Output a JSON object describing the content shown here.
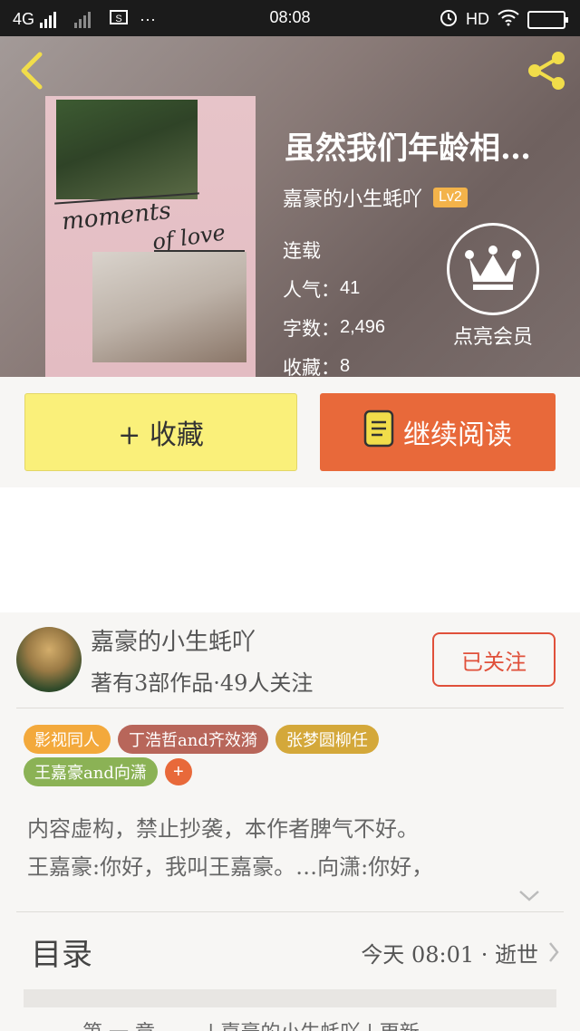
{
  "status_bar": {
    "network": "4G",
    "time": "08:08",
    "hd": "HD",
    "more": "···"
  },
  "book": {
    "title": "虽然我们年龄相…",
    "author": "嘉豪的小生蚝吖",
    "level": "Lv2",
    "status": "连载",
    "popularity_label": "人气：",
    "popularity": "41",
    "words_label": "字数：",
    "words": "2,496",
    "favorites_label": "收藏：",
    "favorites": "8",
    "cover_text_1": "moments",
    "cover_text_2": "of love"
  },
  "vip": {
    "label": "点亮会员"
  },
  "actions": {
    "collect_label": "+ 收藏",
    "read_label": "继续阅读"
  },
  "author_section": {
    "name": "嘉豪的小生蚝吖",
    "meta": "著有3部作品·49人关注",
    "follow_label": "已关注"
  },
  "tags": [
    {
      "label": "影视同人",
      "color": "#f3a93c"
    },
    {
      "label": "丁浩哲and齐效漪",
      "color": "#b8665a"
    },
    {
      "label": "张梦圆柳任",
      "color": "#d4a83a"
    },
    {
      "label": "王嘉豪and向潇",
      "color": "#8bb255"
    }
  ],
  "tag_add": "+",
  "description": {
    "line1": "内容虚构，禁止抄袭，本作者脾气不好。",
    "line2": "王嘉豪:你好，我叫王嘉豪。…向潇:你好，"
  },
  "toc": {
    "label": "目录",
    "update_info": "今天 08:01 · 逝世"
  },
  "peek_text": "—— 第 一 章 ——  |  嘉豪的小生蚝吖  |  更新"
}
